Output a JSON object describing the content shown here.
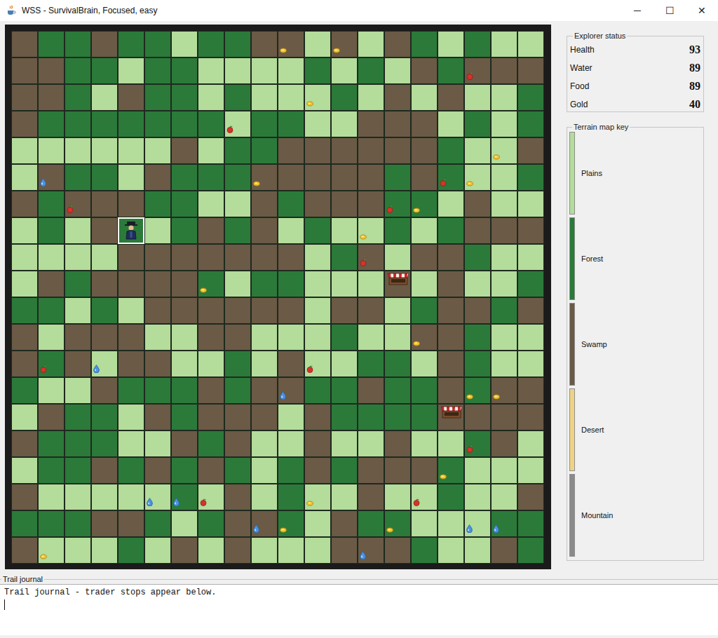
{
  "window": {
    "title": "WSS - SurvivalBrain, Focused, easy",
    "controls": [
      "─",
      "☐",
      "✕"
    ]
  },
  "status": {
    "title": "Explorer status",
    "rows": [
      {
        "label": "Health",
        "value": "93"
      },
      {
        "label": "Water",
        "value": "89"
      },
      {
        "label": "Food",
        "value": "89"
      },
      {
        "label": "Gold",
        "value": "40"
      }
    ]
  },
  "legend": {
    "title": "Terrain map key",
    "items": [
      {
        "label": "Plains",
        "terrain": "plains",
        "color": "#b4dc9b"
      },
      {
        "label": "Forest",
        "terrain": "forest",
        "color": "#2b7a3a"
      },
      {
        "label": "Swamp",
        "terrain": "swamp",
        "color": "#6b5a46"
      },
      {
        "label": "Desert",
        "terrain": "desert",
        "color": "#ecd387"
      },
      {
        "label": "Mountain",
        "terrain": "mountain",
        "color": "#8a8a8a"
      }
    ]
  },
  "map": {
    "rows": [
      [
        "swamp",
        "forest",
        "forest",
        "swamp",
        "forest",
        "forest",
        "plains",
        "forest",
        "forest",
        "swamp",
        "swamp",
        "plains",
        "swamp",
        "plains",
        "swamp",
        "forest",
        "plains",
        "forest",
        "plains",
        "plains"
      ],
      [
        "swamp",
        "swamp",
        "forest",
        "forest",
        "plains",
        "forest",
        "forest",
        "plains",
        "plains",
        "plains",
        "plains",
        "forest",
        "plains",
        "forest",
        "plains",
        "swamp",
        "forest",
        "swamp",
        "swamp",
        "swamp"
      ],
      [
        "swamp",
        "swamp",
        "forest",
        "plains",
        "swamp",
        "forest",
        "forest",
        "plains",
        "forest",
        "plains",
        "plains",
        "plains",
        "forest",
        "plains",
        "swamp",
        "plains",
        "swamp",
        "plains",
        "plains",
        "forest"
      ],
      [
        "swamp",
        "forest",
        "forest",
        "forest",
        "forest",
        "forest",
        "forest",
        "forest",
        "plains",
        "forest",
        "forest",
        "plains",
        "plains",
        "swamp",
        "swamp",
        "swamp",
        "plains",
        "forest",
        "plains",
        "forest"
      ],
      [
        "plains",
        "plains",
        "plains",
        "plains",
        "plains",
        "plains",
        "swamp",
        "plains",
        "forest",
        "forest",
        "swamp",
        "swamp",
        "swamp",
        "swamp",
        "swamp",
        "swamp",
        "forest",
        "plains",
        "plains",
        "swamp"
      ],
      [
        "plains",
        "swamp",
        "forest",
        "forest",
        "plains",
        "swamp",
        "forest",
        "forest",
        "forest",
        "swamp",
        "swamp",
        "swamp",
        "swamp",
        "swamp",
        "forest",
        "swamp",
        "forest",
        "plains",
        "plains",
        "forest"
      ],
      [
        "swamp",
        "forest",
        "swamp",
        "swamp",
        "swamp",
        "forest",
        "forest",
        "plains",
        "plains",
        "swamp",
        "forest",
        "swamp",
        "swamp",
        "swamp",
        "forest",
        "forest",
        "plains",
        "swamp",
        "plains",
        "plains"
      ],
      [
        "plains",
        "forest",
        "plains",
        "swamp",
        "forest",
        "plains",
        "forest",
        "swamp",
        "forest",
        "swamp",
        "plains",
        "forest",
        "plains",
        "plains",
        "forest",
        "plains",
        "forest",
        "swamp",
        "swamp",
        "swamp"
      ],
      [
        "plains",
        "plains",
        "plains",
        "plains",
        "swamp",
        "swamp",
        "swamp",
        "swamp",
        "swamp",
        "swamp",
        "swamp",
        "plains",
        "forest",
        "swamp",
        "plains",
        "swamp",
        "swamp",
        "forest",
        "plains",
        "plains"
      ],
      [
        "plains",
        "swamp",
        "forest",
        "swamp",
        "swamp",
        "swamp",
        "swamp",
        "forest",
        "plains",
        "forest",
        "forest",
        "plains",
        "plains",
        "plains",
        "swamp",
        "plains",
        "swamp",
        "plains",
        "plains",
        "forest"
      ],
      [
        "forest",
        "forest",
        "plains",
        "forest",
        "plains",
        "swamp",
        "swamp",
        "swamp",
        "swamp",
        "swamp",
        "swamp",
        "plains",
        "swamp",
        "swamp",
        "plains",
        "forest",
        "swamp",
        "swamp",
        "forest",
        "swamp"
      ],
      [
        "swamp",
        "plains",
        "swamp",
        "swamp",
        "swamp",
        "plains",
        "plains",
        "swamp",
        "swamp",
        "plains",
        "plains",
        "plains",
        "forest",
        "plains",
        "plains",
        "swamp",
        "swamp",
        "forest",
        "plains",
        "plains"
      ],
      [
        "swamp",
        "forest",
        "swamp",
        "plains",
        "swamp",
        "swamp",
        "plains",
        "plains",
        "forest",
        "plains",
        "swamp",
        "plains",
        "plains",
        "forest",
        "forest",
        "plains",
        "swamp",
        "forest",
        "plains",
        "plains"
      ],
      [
        "forest",
        "plains",
        "plains",
        "swamp",
        "forest",
        "forest",
        "forest",
        "swamp",
        "forest",
        "swamp",
        "swamp",
        "forest",
        "forest",
        "swamp",
        "forest",
        "forest",
        "swamp",
        "forest",
        "swamp",
        "swamp"
      ],
      [
        "plains",
        "swamp",
        "forest",
        "forest",
        "plains",
        "swamp",
        "forest",
        "swamp",
        "swamp",
        "swamp",
        "plains",
        "swamp",
        "forest",
        "forest",
        "forest",
        "forest",
        "swamp",
        "swamp",
        "swamp",
        "swamp"
      ],
      [
        "swamp",
        "forest",
        "forest",
        "forest",
        "plains",
        "plains",
        "swamp",
        "forest",
        "swamp",
        "plains",
        "plains",
        "swamp",
        "plains",
        "plains",
        "swamp",
        "plains",
        "plains",
        "forest",
        "swamp",
        "plains"
      ],
      [
        "plains",
        "forest",
        "forest",
        "swamp",
        "forest",
        "swamp",
        "forest",
        "swamp",
        "forest",
        "plains",
        "forest",
        "swamp",
        "forest",
        "swamp",
        "swamp",
        "swamp",
        "forest",
        "plains",
        "plains",
        "plains"
      ],
      [
        "swamp",
        "plains",
        "plains",
        "plains",
        "plains",
        "plains",
        "forest",
        "plains",
        "swamp",
        "plains",
        "forest",
        "plains",
        "plains",
        "swamp",
        "plains",
        "plains",
        "forest",
        "plains",
        "plains",
        "swamp"
      ],
      [
        "forest",
        "forest",
        "forest",
        "swamp",
        "swamp",
        "forest",
        "plains",
        "forest",
        "swamp",
        "swamp",
        "forest",
        "plains",
        "swamp",
        "forest",
        "forest",
        "plains",
        "plains",
        "plains",
        "forest",
        "forest"
      ],
      [
        "swamp",
        "plains",
        "plains",
        "plains",
        "forest",
        "plains",
        "swamp",
        "plains",
        "swamp",
        "plains",
        "plains",
        "plains",
        "swamp",
        "swamp",
        "swamp",
        "forest",
        "plains",
        "plains",
        "swamp",
        "forest"
      ]
    ],
    "player": {
      "row": 7,
      "col": 4,
      "selected": true
    },
    "items": [
      {
        "row": 0,
        "col": 10,
        "kind": "gold"
      },
      {
        "row": 0,
        "col": 12,
        "kind": "gold"
      },
      {
        "row": 1,
        "col": 17,
        "kind": "food"
      },
      {
        "row": 2,
        "col": 11,
        "kind": "gold"
      },
      {
        "row": 3,
        "col": 8,
        "kind": "food"
      },
      {
        "row": 4,
        "col": 18,
        "kind": "gold"
      },
      {
        "row": 5,
        "col": 1,
        "kind": "water"
      },
      {
        "row": 5,
        "col": 9,
        "kind": "gold"
      },
      {
        "row": 5,
        "col": 16,
        "kind": "food"
      },
      {
        "row": 5,
        "col": 17,
        "kind": "gold"
      },
      {
        "row": 6,
        "col": 2,
        "kind": "food"
      },
      {
        "row": 6,
        "col": 14,
        "kind": "food"
      },
      {
        "row": 6,
        "col": 15,
        "kind": "gold"
      },
      {
        "row": 7,
        "col": 13,
        "kind": "gold"
      },
      {
        "row": 8,
        "col": 13,
        "kind": "food"
      },
      {
        "row": 9,
        "col": 14,
        "kind": "trader"
      },
      {
        "row": 9,
        "col": 7,
        "kind": "gold"
      },
      {
        "row": 11,
        "col": 15,
        "kind": "gold"
      },
      {
        "row": 12,
        "col": 1,
        "kind": "food"
      },
      {
        "row": 12,
        "col": 3,
        "kind": "water"
      },
      {
        "row": 12,
        "col": 11,
        "kind": "food"
      },
      {
        "row": 13,
        "col": 10,
        "kind": "water"
      },
      {
        "row": 13,
        "col": 17,
        "kind": "gold"
      },
      {
        "row": 13,
        "col": 18,
        "kind": "gold"
      },
      {
        "row": 14,
        "col": 16,
        "kind": "trader"
      },
      {
        "row": 15,
        "col": 17,
        "kind": "food"
      },
      {
        "row": 16,
        "col": 16,
        "kind": "gold"
      },
      {
        "row": 17,
        "col": 5,
        "kind": "water"
      },
      {
        "row": 17,
        "col": 6,
        "kind": "water"
      },
      {
        "row": 17,
        "col": 7,
        "kind": "food"
      },
      {
        "row": 17,
        "col": 11,
        "kind": "gold"
      },
      {
        "row": 17,
        "col": 15,
        "kind": "food"
      },
      {
        "row": 18,
        "col": 9,
        "kind": "water"
      },
      {
        "row": 18,
        "col": 10,
        "kind": "gold"
      },
      {
        "row": 18,
        "col": 14,
        "kind": "gold"
      },
      {
        "row": 18,
        "col": 17,
        "kind": "water"
      },
      {
        "row": 18,
        "col": 18,
        "kind": "water"
      },
      {
        "row": 19,
        "col": 1,
        "kind": "gold"
      },
      {
        "row": 19,
        "col": 13,
        "kind": "water"
      }
    ]
  },
  "journal": {
    "title": "Trail journal",
    "text": "Trail journal - trader stops appear below."
  }
}
